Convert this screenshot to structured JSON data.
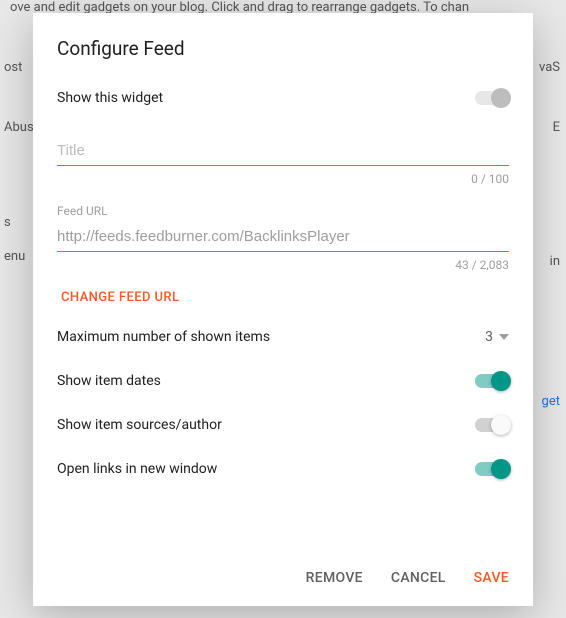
{
  "background": {
    "top_text": "ove and edit gadgets on your blog. Click and drag to rearrange gadgets. To chan",
    "left_items": [
      "ost",
      "Abus",
      "s",
      "enu"
    ],
    "right_items": [
      "vaS",
      "E",
      "in",
      "get"
    ]
  },
  "modal": {
    "title": "Configure Feed",
    "show_widget": {
      "label": "Show this widget",
      "value": false
    },
    "title_field": {
      "label": "Title",
      "value": "",
      "placeholder": "Title",
      "counter": "0 / 100"
    },
    "url_field": {
      "label": "Feed URL",
      "value": "http://feeds.feedburner.com/BacklinksPlayer",
      "counter": "43 / 2,083"
    },
    "change_link": "CHANGE FEED URL",
    "max_items": {
      "label": "Maximum number of shown items",
      "value": "3"
    },
    "show_dates": {
      "label": "Show item dates",
      "value": true
    },
    "show_sources": {
      "label": "Show item sources/author",
      "value": false
    },
    "open_new_window": {
      "label": "Open links in new window",
      "value": true
    },
    "footer": {
      "remove": "REMOVE",
      "cancel": "CANCEL",
      "save": "SAVE"
    }
  }
}
